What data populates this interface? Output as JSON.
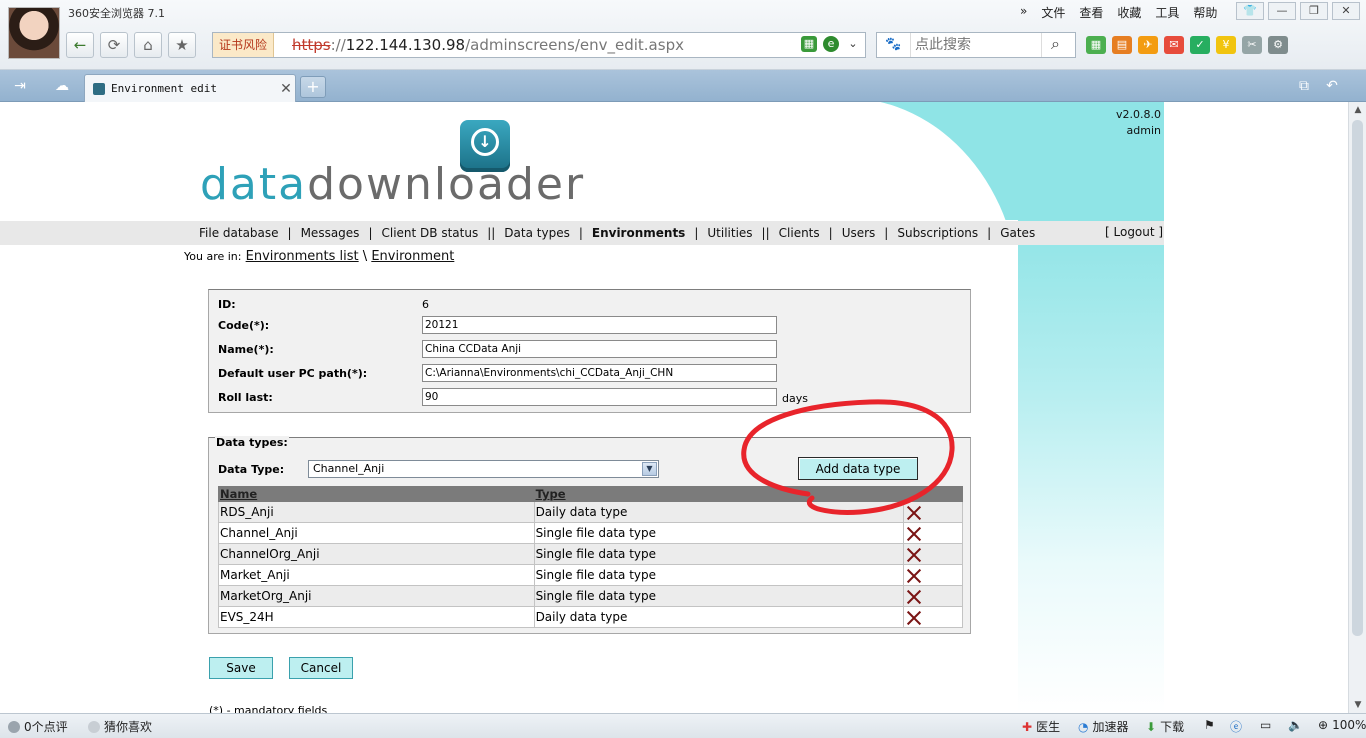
{
  "browser": {
    "name": "360安全浏览器 7.1",
    "menu": [
      "文件",
      "查看",
      "收藏",
      "工具",
      "帮助"
    ],
    "cert_warning": "证书风险",
    "url_scheme": "https",
    "url_sep": "://",
    "url_host": "122.144.130.98",
    "url_path": "/adminscreens/env_edit.aspx",
    "search_placeholder": "点此搜索",
    "tab_title": "Environment edit",
    "status_left": [
      "0个点评",
      "猜你喜欢"
    ],
    "status_right": [
      "医生",
      "加速器",
      "下载"
    ],
    "zoom": "100%"
  },
  "header": {
    "version": "v2.0.8.0",
    "user": "admin",
    "logo_part1": "data",
    "logo_part2": "downloader"
  },
  "nav": {
    "items": [
      "File database",
      "Messages",
      "Client DB status",
      "Data types",
      "Environments",
      "Utilities",
      "Clients",
      "Users",
      "Subscriptions",
      "Gates"
    ],
    "separators": [
      "|",
      "|",
      "||",
      "|",
      "|",
      "||",
      "|",
      "|",
      "|"
    ],
    "logout": "[ Logout ]"
  },
  "breadcrumb": {
    "label": "You are in:",
    "links": [
      "Environments list",
      "Environment"
    ],
    "sep": "\\"
  },
  "form": {
    "id_label": "ID:",
    "id_value": "6",
    "code_label": "Code(*):",
    "code_value": "20121",
    "name_label": "Name(*):",
    "name_value": "China CCData Anji",
    "path_label": "Default user PC path(*):",
    "path_value": "C:\\Arianna\\Environments\\chi_CCData_Anji_CHN",
    "roll_label": "Roll last:",
    "roll_value": "90",
    "roll_unit": "days"
  },
  "data_types": {
    "legend": "Data types:",
    "select_label": "Data Type:",
    "selected": "Channel_Anji",
    "add_button": "Add data type",
    "columns": [
      "Name",
      "Type",
      ""
    ],
    "rows": [
      {
        "name": "RDS_Anji",
        "type": "Daily data type"
      },
      {
        "name": "Channel_Anji",
        "type": "Single file data type"
      },
      {
        "name": "ChannelOrg_Anji",
        "type": "Single file data type"
      },
      {
        "name": "Market_Anji",
        "type": "Single file data type"
      },
      {
        "name": "MarketOrg_Anji",
        "type": "Single file data type"
      },
      {
        "name": "EVS_24H",
        "type": "Daily data type"
      }
    ]
  },
  "actions": {
    "save": "Save",
    "cancel": "Cancel",
    "mandatory_note": "(*) - mandatory fields"
  },
  "annotation": {
    "circle_color": "#e8242b"
  },
  "colors": {
    "teal": "#8fe4e6",
    "button": "#bdeff0",
    "logo_teal": "#2ea1b8",
    "logo_gray": "#6b6b6b"
  }
}
